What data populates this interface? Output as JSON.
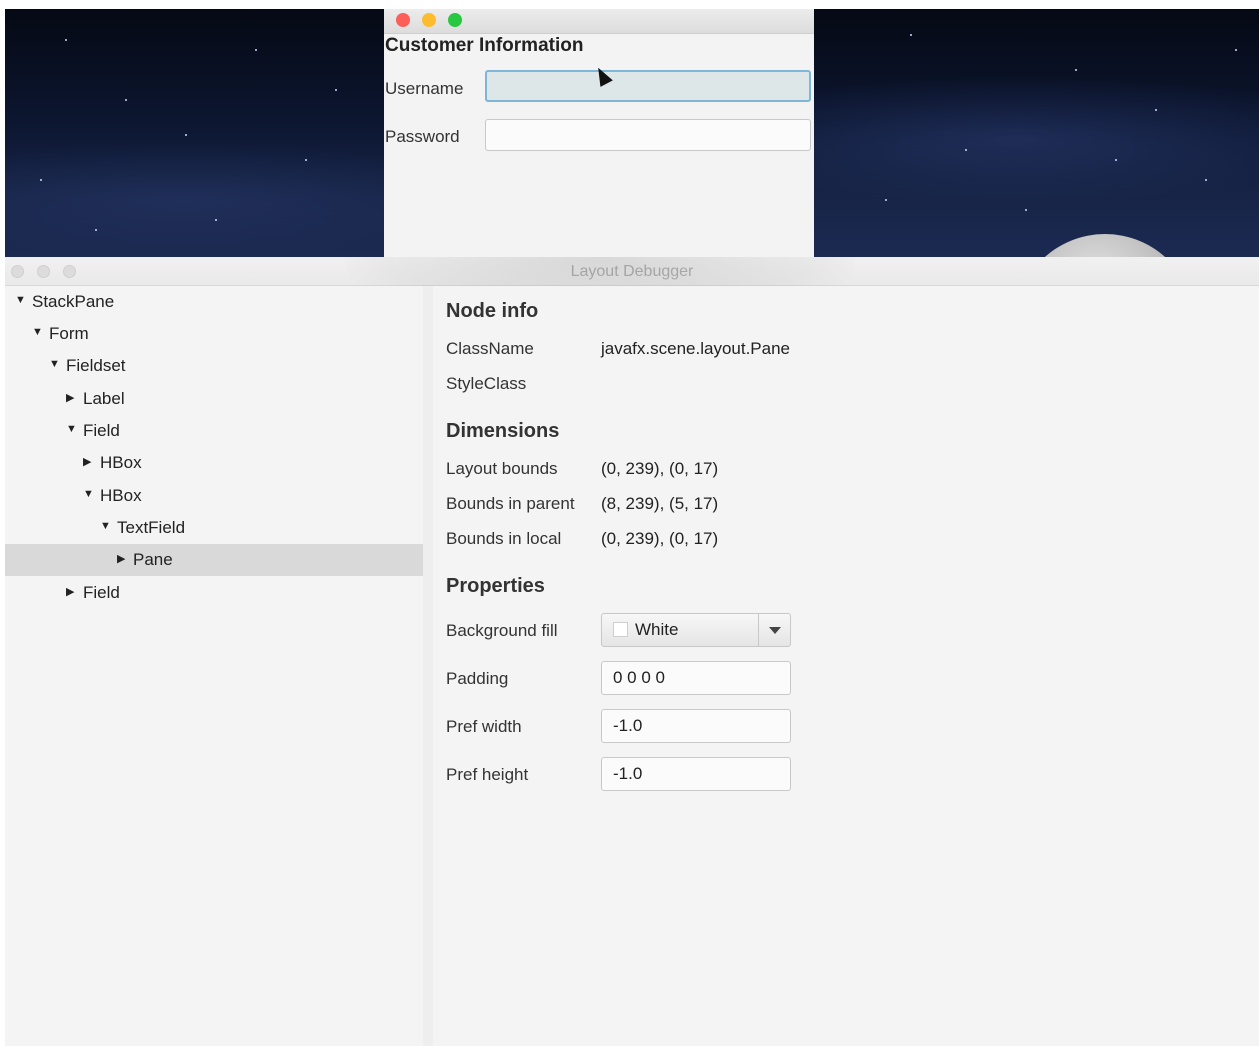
{
  "customer_window": {
    "title": "Customer Information",
    "fields": [
      {
        "label": "Username",
        "value": "",
        "focused": true
      },
      {
        "label": "Password",
        "value": "",
        "focused": false
      }
    ]
  },
  "debugger_window": {
    "title": "Layout Debugger",
    "tree": [
      {
        "label": "StackPane",
        "depth": 0,
        "expanded": true
      },
      {
        "label": "Form",
        "depth": 1,
        "expanded": true
      },
      {
        "label": "Fieldset",
        "depth": 2,
        "expanded": true
      },
      {
        "label": "Label",
        "depth": 3,
        "expanded": false
      },
      {
        "label": "Field",
        "depth": 3,
        "expanded": true
      },
      {
        "label": "HBox",
        "depth": 4,
        "expanded": false
      },
      {
        "label": "HBox",
        "depth": 4,
        "expanded": true
      },
      {
        "label": "TextField",
        "depth": 5,
        "expanded": true
      },
      {
        "label": "Pane",
        "depth": 6,
        "expanded": false,
        "selected": true
      },
      {
        "label": "Field",
        "depth": 3,
        "expanded": false
      }
    ],
    "node_info": {
      "heading": "Node info",
      "class_name_label": "ClassName",
      "class_name_value": "javafx.scene.layout.Pane",
      "style_class_label": "StyleClass",
      "style_class_value": ""
    },
    "dimensions": {
      "heading": "Dimensions",
      "layout_bounds_label": "Layout bounds",
      "layout_bounds_value": "(0, 239), (0, 17)",
      "bounds_in_parent_label": "Bounds in parent",
      "bounds_in_parent_value": "(8, 239), (5, 17)",
      "bounds_in_local_label": "Bounds in local",
      "bounds_in_local_value": "(0, 239), (0, 17)"
    },
    "properties": {
      "heading": "Properties",
      "background_fill_label": "Background fill",
      "background_fill_value": "White",
      "padding_label": "Padding",
      "padding_value": "0 0 0 0",
      "pref_width_label": "Pref width",
      "pref_width_value": "-1.0",
      "pref_height_label": "Pref height",
      "pref_height_value": "-1.0"
    }
  },
  "colors": {
    "close": "#fc5f57",
    "minimize": "#fdbc2e",
    "maximize": "#28c840",
    "focus_ring": "#7fb6d8",
    "selection": "#d9d9d9"
  }
}
